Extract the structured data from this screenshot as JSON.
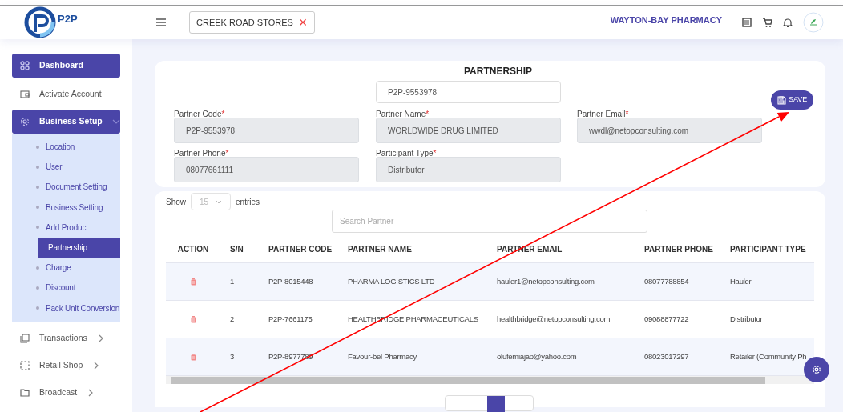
{
  "header": {
    "logo_text": "P2P",
    "store_select": {
      "value": "CREEK ROAD STORES",
      "clear": "×"
    },
    "business_name": "WAYTON-BAY PHARMACY"
  },
  "sidebar": {
    "items": [
      {
        "kind": "link",
        "label": "Dashboard",
        "selected": true
      },
      {
        "kind": "link",
        "label": "Activate Account",
        "selected": false
      },
      {
        "kind": "group",
        "label": "Business Setup",
        "expanded": true,
        "children": [
          {
            "label": "Location",
            "selected": false
          },
          {
            "label": "User",
            "selected": false
          },
          {
            "label": "Document Setting",
            "selected": false
          },
          {
            "label": "Business Setting",
            "selected": false
          },
          {
            "label": "Add Product",
            "selected": false
          },
          {
            "label": "Partnership",
            "selected": true
          },
          {
            "label": "Charge",
            "selected": false
          },
          {
            "label": "Discount",
            "selected": false
          },
          {
            "label": "Pack Unit Conversion",
            "selected": false
          }
        ]
      },
      {
        "kind": "group",
        "label": "Transactions",
        "expanded": false
      },
      {
        "kind": "group",
        "label": "Retail Shop",
        "expanded": false
      },
      {
        "kind": "group",
        "label": "Broadcast",
        "expanded": false
      }
    ]
  },
  "form": {
    "title": "PARTNERSHIP",
    "lookup_value": "P2P-9553978",
    "save_button": "SAVE",
    "fields": [
      {
        "label": "Partner Code",
        "required_mark": "*",
        "value": "P2P-9553978"
      },
      {
        "label": "Partner Name",
        "required_mark": "*",
        "value": "WORLDWIDE DRUG LIMITED"
      },
      {
        "label": "Partner Email",
        "required_mark": "*",
        "value": "wwdl@netopconsulting.com"
      },
      {
        "label": "Partner Phone",
        "required_mark": "*",
        "value": "08077661111"
      },
      {
        "label": "Participant Type",
        "required_mark": "*",
        "value": "Distributor"
      }
    ]
  },
  "table": {
    "show_label": "Show",
    "page_size": "15",
    "entries_label": "entries",
    "search": {
      "placeholder": "Search Partner"
    },
    "columns": [
      "ACTION",
      "S/N",
      "PARTNER CODE",
      "PARTNER NAME",
      "PARTNER EMAIL",
      "PARTNER PHONE",
      "PARTICIPANT TYPE"
    ],
    "rows": [
      [
        "",
        "1",
        "P2P-8015448",
        "PHARMA LOGISTICS LTD",
        "hauler1@netopconsulting.com",
        "08077788854",
        "Hauler"
      ],
      [
        "",
        "2",
        "P2P-7661175",
        "HEALTHBRIDGE PHARMACEUTICALS",
        "healthbridge@netopconsulting.com",
        "09088877722",
        "Distributor"
      ],
      [
        "",
        "3",
        "P2P-8977789",
        "Favour-bel Pharmacy",
        "olufemiajao@yahoo.com",
        "08023017297",
        "Retailer (Community Ph"
      ]
    ]
  }
}
